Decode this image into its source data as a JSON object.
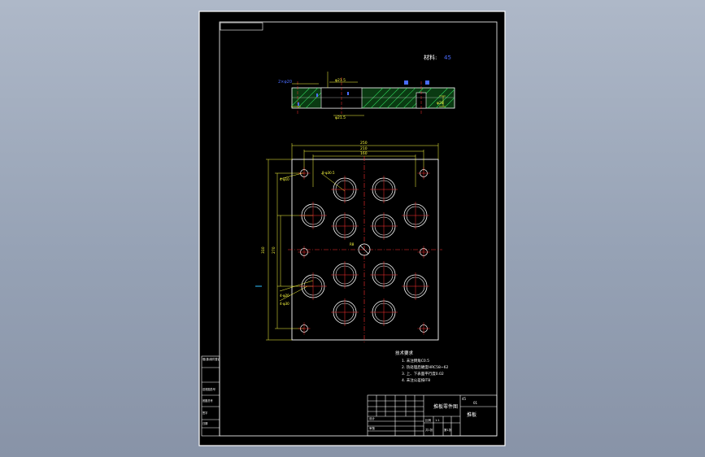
{
  "drawing": {
    "material_label": "材料:",
    "material_value": "45",
    "section_view": {
      "dim_top_left": "2×φ20",
      "dim_top": "φ21.5",
      "dim_right_label": "φ28",
      "dim_bottom": "φ21.5"
    },
    "plan_view": {
      "dim_overall_width": "250",
      "dim_width_2": "210",
      "dim_width_3": "160",
      "dim_overall_height": "310",
      "dim_height_2": "270",
      "dim_hole_top_left": "4-φ10",
      "dim_hole_top_right": "8-φ30.5",
      "dim_center": "R8",
      "dim_hole_bottom_left": "4-φ20",
      "dim_hole_bottom_left_2": "4-φ30"
    },
    "notes": {
      "title": "技术要求",
      "lines": [
        "1. 未注倒角C0.5",
        "2. 热处理后硬度HRC58~62",
        "3. 上、下表面平行度0.02",
        "4. 未注公差按IT8"
      ]
    },
    "title_block": {
      "part_name": "推板",
      "part_code": "推板零件图",
      "scale_label": "比例",
      "scale_value": "1:1",
      "sheet_label": "共1张",
      "sheet_value": "第1张",
      "designer": "设计",
      "checker": "审核",
      "material": "45",
      "drawing_no": "01"
    },
    "left_block": {
      "rows": [
        "借(通)用件登记",
        "旧底图总号",
        "底图总号",
        "签字",
        "日期"
      ]
    }
  }
}
